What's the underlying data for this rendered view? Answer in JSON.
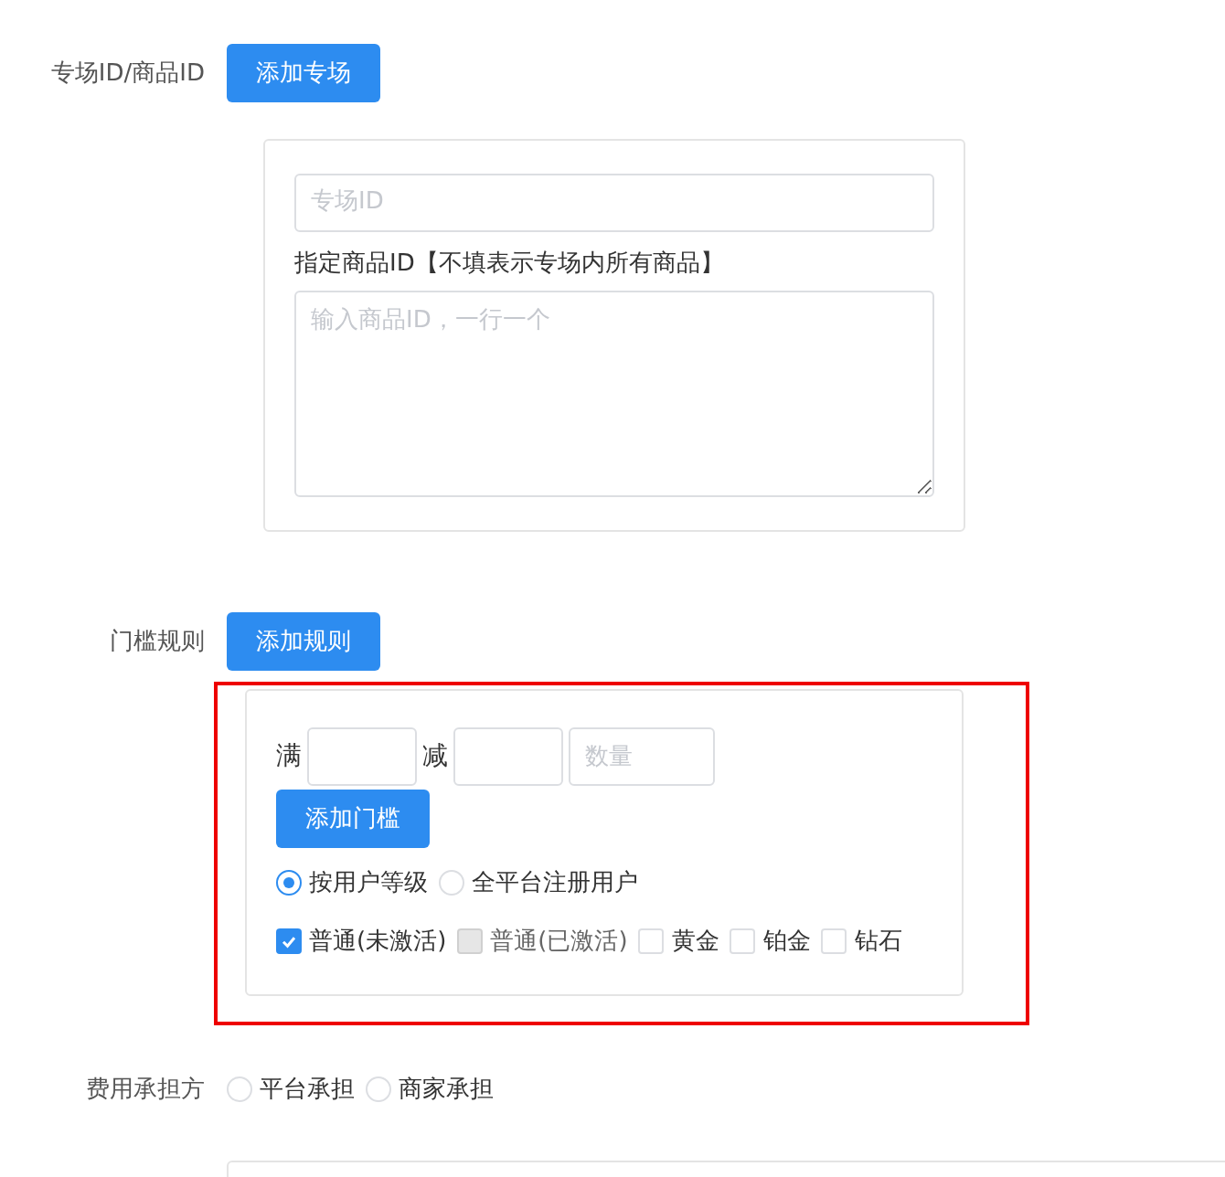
{
  "special_row": {
    "label": "专场ID/商品ID",
    "button": "添加专场"
  },
  "special_card": {
    "id_placeholder": "专场ID",
    "goods_label": "指定商品ID【不填表示专场内所有商品】",
    "goods_placeholder": "输入商品ID，一行一个"
  },
  "rule_row": {
    "label": "门槛规则",
    "button": "添加规则"
  },
  "rule_card": {
    "highlighted": true,
    "full_label": "满",
    "minus_label": "减",
    "qty_placeholder": "数量",
    "add_button": "添加门槛",
    "scopes": [
      {
        "label": "按用户等级",
        "selected": true
      },
      {
        "label": "全平台注册用户",
        "selected": false
      }
    ],
    "levels": [
      {
        "label": "普通(未激活)",
        "checked": true,
        "disabled": false
      },
      {
        "label": "普通(已激活)",
        "checked": false,
        "disabled": true
      },
      {
        "label": "黄金",
        "checked": false,
        "disabled": false
      },
      {
        "label": "铂金",
        "checked": false,
        "disabled": false
      },
      {
        "label": "钻石",
        "checked": false,
        "disabled": false
      }
    ]
  },
  "cost_row": {
    "label": "费用承担方",
    "options": [
      {
        "label": "平台承担",
        "selected": false
      },
      {
        "label": "商家承担",
        "selected": false
      }
    ]
  }
}
